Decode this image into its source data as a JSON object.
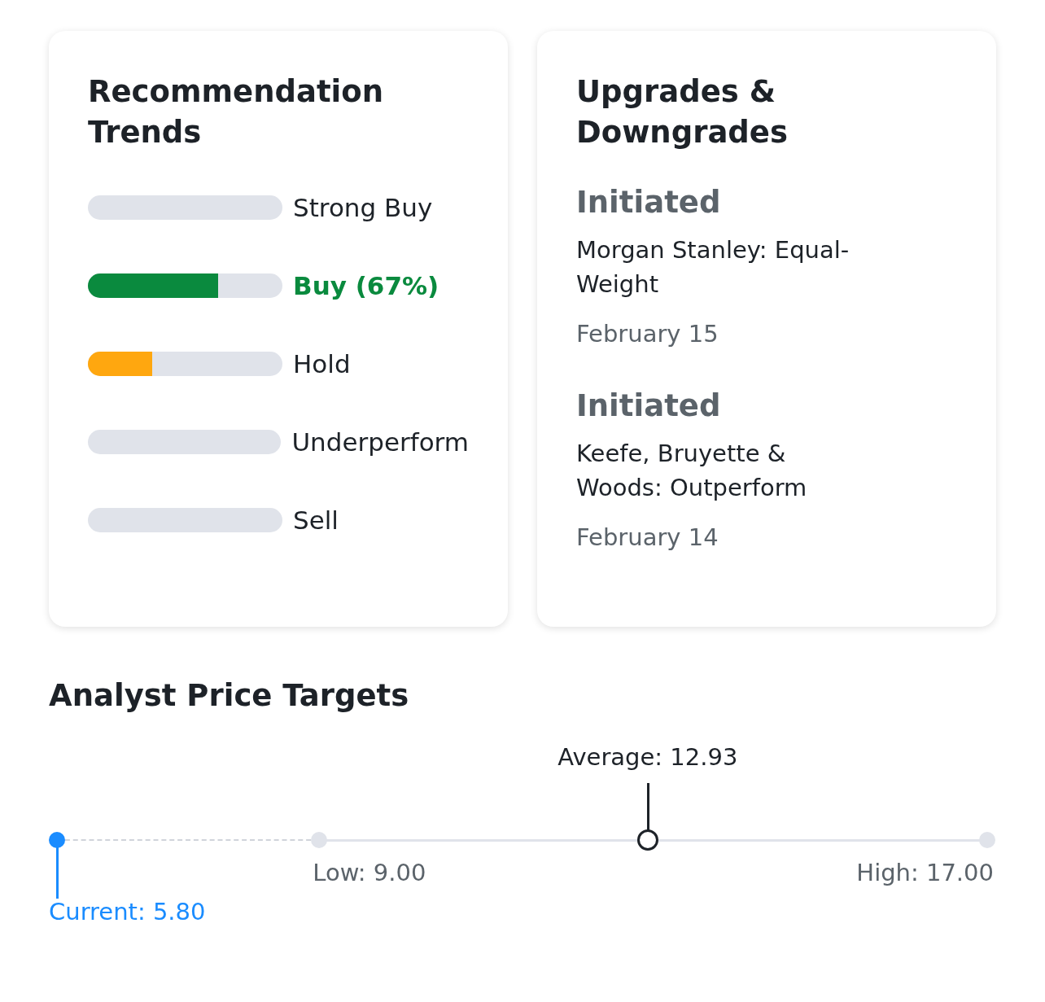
{
  "recommendation_trends": {
    "title": "Recommendation Trends",
    "ratings": [
      {
        "label": "Strong Buy",
        "highlighted": false
      },
      {
        "label": "Buy (67%)",
        "level": 0.67,
        "color": "#0a8a3e",
        "highlighted": true
      },
      {
        "label": "Hold",
        "level": 0.33,
        "color": "#ffa70f",
        "highlighted": false
      },
      {
        "label": "Underperform",
        "highlighted": false
      },
      {
        "label": "Sell",
        "highlighted": false
      }
    ]
  },
  "upgrades_downgrades": {
    "title": "Upgrades & Downgrades",
    "items": [
      {
        "action": "Initiated",
        "firm_rating": "Morgan Stanley: Equal-Weight",
        "date": "February 15"
      },
      {
        "action": "Initiated",
        "firm_rating": "Keefe, Bruyette & Woods: Outperform",
        "date": "February 14"
      }
    ]
  },
  "analyst_price_targets": {
    "title": "Analyst Price Targets",
    "markers": [
      {
        "kind": "current",
        "label": "Current: 5.80",
        "level": 0
      },
      {
        "kind": "low",
        "label": "Low: 9.00",
        "level": 0.282
      },
      {
        "kind": "average",
        "label": "Average: 12.93",
        "level": 0.635
      },
      {
        "kind": "high",
        "label": "High: 17.00",
        "level": 1
      }
    ]
  }
}
